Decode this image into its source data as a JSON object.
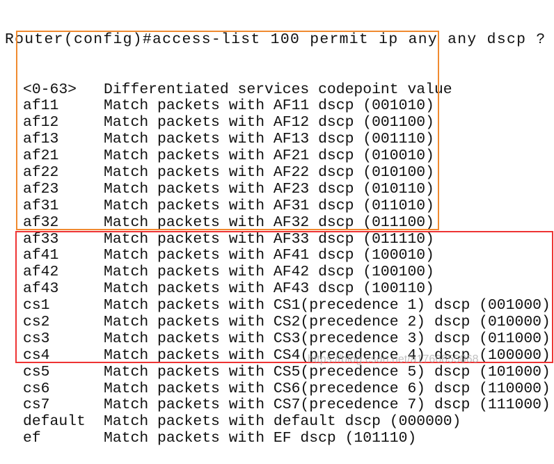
{
  "prompt_line": "Router(config)#access-list 100 permit ip any any dscp ?",
  "rows": [
    {
      "keyword": "<0-63>",
      "description": "Differentiated services codepoint value"
    },
    {
      "keyword": "af11",
      "description": "Match packets with AF11 dscp (001010)"
    },
    {
      "keyword": "af12",
      "description": "Match packets with AF12 dscp (001100)"
    },
    {
      "keyword": "af13",
      "description": "Match packets with AF13 dscp (001110)"
    },
    {
      "keyword": "af21",
      "description": "Match packets with AF21 dscp (010010)"
    },
    {
      "keyword": "af22",
      "description": "Match packets with AF22 dscp (010100)"
    },
    {
      "keyword": "af23",
      "description": "Match packets with AF23 dscp (010110)"
    },
    {
      "keyword": "af31",
      "description": "Match packets with AF31 dscp (011010)"
    },
    {
      "keyword": "af32",
      "description": "Match packets with AF32 dscp (011100)"
    },
    {
      "keyword": "af33",
      "description": "Match packets with AF33 dscp (011110)"
    },
    {
      "keyword": "af41",
      "description": "Match packets with AF41 dscp (100010)"
    },
    {
      "keyword": "af42",
      "description": "Match packets with AF42 dscp (100100)"
    },
    {
      "keyword": "af43",
      "description": "Match packets with AF43 dscp (100110)"
    },
    {
      "keyword": "cs1",
      "description": "Match packets with CS1(precedence 1) dscp (001000)"
    },
    {
      "keyword": "cs2",
      "description": "Match packets with CS2(precedence 2) dscp (010000)"
    },
    {
      "keyword": "cs3",
      "description": "Match packets with CS3(precedence 3) dscp (011000)"
    },
    {
      "keyword": "cs4",
      "description": "Match packets with CS4(precedence 4) dscp (100000)"
    },
    {
      "keyword": "cs5",
      "description": "Match packets with CS5(precedence 5) dscp (101000)"
    },
    {
      "keyword": "cs6",
      "description": "Match packets with CS6(precedence 6) dscp (110000)"
    },
    {
      "keyword": "cs7",
      "description": "Match packets with CS7(precedence 7) dscp (111000)"
    },
    {
      "keyword": "default",
      "description": "Match packets with default dscp (000000)"
    },
    {
      "keyword": "ef",
      "description": "Match packets with EF dscp (101110)"
    }
  ],
  "highlight_colors": {
    "af_box": "#f08a30",
    "cs_box": "#ee3333"
  },
  "watermark": "https://blog.csdn.net/a1766855068"
}
